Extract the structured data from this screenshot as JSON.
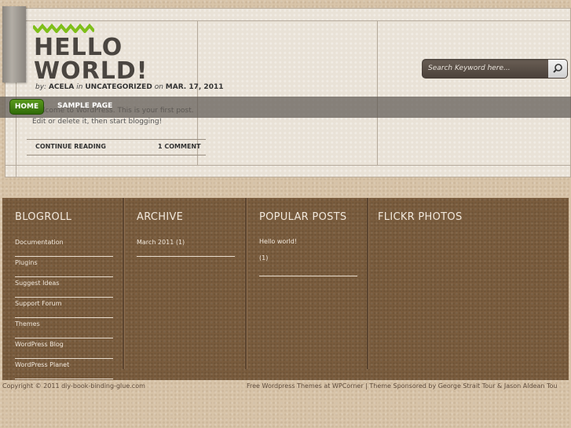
{
  "post": {
    "title_line1": "HELLO",
    "title_line2": "WORLD!",
    "meta_by": "by:",
    "meta_author": "ACELA",
    "meta_in": "in",
    "meta_category": "UNCATEGORIZED",
    "meta_on": "on",
    "meta_date": "MAR. 17, 2011",
    "excerpt": "Welcome to WordPress. This is your first post. Edit or delete it, then start blogging!",
    "continue_label": "CONTINUE READING",
    "comments_label": "1 COMMENT"
  },
  "nav": {
    "items": [
      {
        "label": "HOME"
      },
      {
        "label": "SAMPLE PAGE"
      }
    ]
  },
  "search": {
    "placeholder": "Search Keyword here..."
  },
  "widgets": {
    "blogroll": {
      "title": "BLOGROLL",
      "items": [
        "Documentation",
        "Plugins",
        "Suggest Ideas",
        "Support Forum",
        "Themes",
        "WordPress Blog",
        "WordPress Planet"
      ]
    },
    "archive": {
      "title": "ARCHIVE",
      "items": [
        "March 2011 (1)"
      ]
    },
    "popular": {
      "title": "POPULAR POSTS",
      "post_title": "Hello world!",
      "post_count": "(1)"
    },
    "flickr": {
      "title": "FLICKR PHOTOS"
    }
  },
  "footer": {
    "copyright": "Copyright © 2011 diy-book-binding-glue.com",
    "credits": "Free Wordpress Themes at WPCorner | Theme Sponsored by George Strait Tour & Jason Aldean Tou"
  },
  "colors": {
    "accent": "#3f7f12",
    "footer_bg": "#7a5c3d",
    "navbar": "#5f5a54"
  }
}
